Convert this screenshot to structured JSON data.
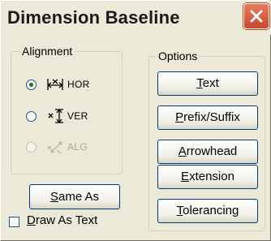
{
  "window": {
    "title": "Dimension Baseline",
    "close_icon": "close-icon"
  },
  "alignment": {
    "label": "Alignment",
    "options": [
      {
        "label": "HOR",
        "icon": "horizontal-dimension-icon",
        "selected": true,
        "enabled": true
      },
      {
        "label": "VER",
        "icon": "vertical-dimension-icon",
        "selected": false,
        "enabled": true
      },
      {
        "label": "ALG",
        "icon": "aligned-dimension-icon",
        "selected": false,
        "enabled": false
      }
    ]
  },
  "options": {
    "label": "Options",
    "buttons": [
      {
        "label": "Text",
        "mnemonic": "T"
      },
      {
        "label": "Prefix/Suffix",
        "mnemonic": "P"
      },
      {
        "label": "Arrowhead",
        "mnemonic": "A"
      },
      {
        "label": "Extension",
        "mnemonic": "E"
      },
      {
        "label": "Tolerancing",
        "mnemonic": "T"
      }
    ]
  },
  "same_as_button": "Same As",
  "draw_as_text": {
    "label": "Draw As Text",
    "checked": false
  },
  "colors": {
    "face": "#ece9d8",
    "close_button": "#d6563c",
    "button_border": "#003c74"
  }
}
